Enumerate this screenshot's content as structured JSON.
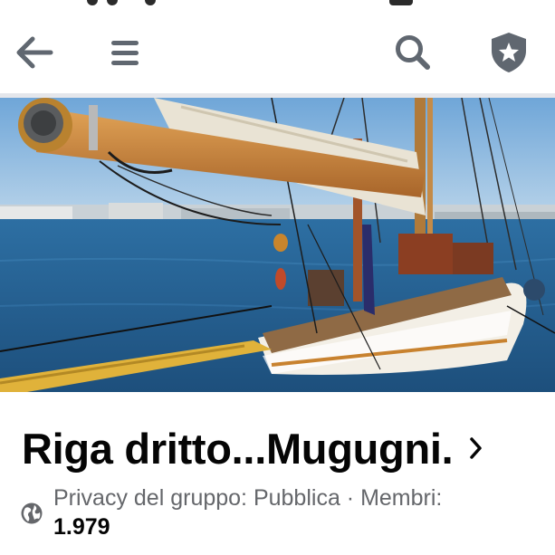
{
  "header": {
    "back_icon": "arrow-left-icon",
    "menu_icon": "hamburger-menu-icon",
    "search_icon": "search-icon",
    "shield_icon": "shield-star-icon",
    "icon_color": "#606770"
  },
  "cover": {
    "description_icon": "cover-photo"
  },
  "group": {
    "name": "Riga dritto...Mugugni.",
    "privacy_prefix": "Privacy del gruppo: Pubblica · Membri:",
    "member_count": "1.979",
    "privacy_icon": "globe-icon"
  },
  "colors": {
    "title": "#050505",
    "secondary": "#65676b",
    "divider": "#e4e6eb"
  }
}
